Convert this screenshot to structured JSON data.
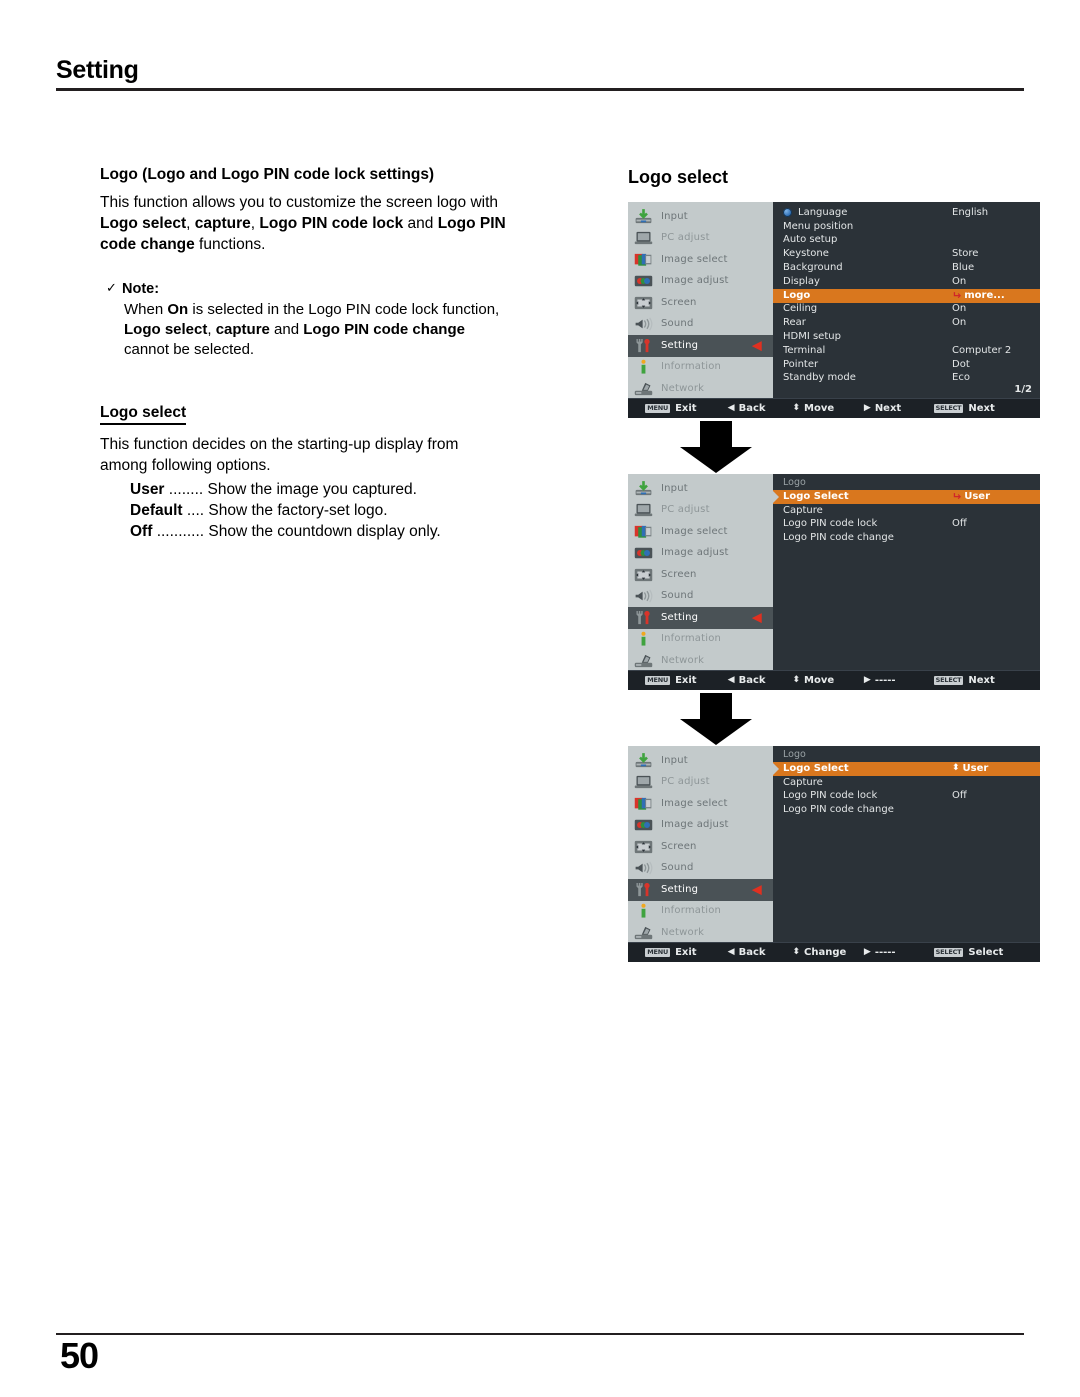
{
  "page": {
    "chapter_title": "Setting",
    "page_number": "50"
  },
  "left_column": {
    "section_heading": "Logo (Logo and Logo PIN code lock settings)",
    "intro_line1": "This function allows you to customize the screen logo with",
    "intro_b1": "Logo select",
    "intro_t1": ", ",
    "intro_b2": "capture",
    "intro_t2": ", ",
    "intro_b3": "Logo PIN code lock",
    "intro_t3": " and ",
    "intro_b4": "Logo PIN",
    "intro_b5": "code change",
    "intro_t4": " functions.",
    "note": {
      "check_glyph": "✓",
      "title": "Note:",
      "line1_a": "When ",
      "line1_b": "On",
      "line1_c": " is selected in the Logo PIN code lock function,",
      "line2_b1": "Logo select",
      "line2_t1": ", ",
      "line2_b2": "capture",
      "line2_t2": " and ",
      "line2_b3": "Logo PIN code change",
      "line3": "cannot be selected."
    },
    "subsection": {
      "heading": "Logo select",
      "desc_line1": "This function decides on the starting-up display from",
      "desc_line2": "among following options.",
      "options": [
        {
          "name": "User",
          "dots": " ........ ",
          "desc": "Show the image you captured."
        },
        {
          "name": "Default",
          "dots": " .... ",
          "desc": "Show the factory-set logo."
        },
        {
          "name": "Off",
          "dots": " ........... ",
          "desc": "Show the countdown display only."
        }
      ]
    }
  },
  "right_column": {
    "heading": "Logo select",
    "sidebar_items": [
      {
        "label": "Input",
        "icon": "input-icon"
      },
      {
        "label": "PC adjust",
        "icon": "pc-adjust-icon"
      },
      {
        "label": "Image select",
        "icon": "image-select-icon"
      },
      {
        "label": "Image adjust",
        "icon": "image-adjust-icon"
      },
      {
        "label": "Screen",
        "icon": "screen-icon"
      },
      {
        "label": "Sound",
        "icon": "sound-icon"
      },
      {
        "label": "Setting",
        "icon": "setting-icon"
      },
      {
        "label": "Information",
        "icon": "information-icon"
      },
      {
        "label": "Network",
        "icon": "network-icon"
      }
    ],
    "sidebar_caret": "◀",
    "osd_panels": [
      {
        "id": "setting-menu",
        "title": "",
        "rows": [
          {
            "label": "Language",
            "value": "English",
            "icon": "globe-icon",
            "selected": false
          },
          {
            "label": "Menu position",
            "value": "",
            "selected": false
          },
          {
            "label": "Auto setup",
            "value": "",
            "selected": false
          },
          {
            "label": "Keystone",
            "value": "Store",
            "selected": false
          },
          {
            "label": "Background",
            "value": "Blue",
            "selected": false
          },
          {
            "label": "Display",
            "value": "On",
            "selected": false
          },
          {
            "label": "Logo",
            "value": "more...",
            "selected": true,
            "marker": "return-arrow"
          },
          {
            "label": "Ceiling",
            "value": "On",
            "selected": false
          },
          {
            "label": "Rear",
            "value": "On",
            "selected": false
          },
          {
            "label": "HDMI setup",
            "value": "",
            "selected": false
          },
          {
            "label": "Terminal",
            "value": "Computer 2",
            "selected": false
          },
          {
            "label": "Pointer",
            "value": "Dot",
            "selected": false
          },
          {
            "label": "Standby mode",
            "value": "Eco",
            "selected": false
          }
        ],
        "page_indicator": "1/2",
        "footer": [
          {
            "keycap": "MENU",
            "glyph": "",
            "label": "Exit"
          },
          {
            "keycap": "",
            "glyph": "◀",
            "label": "Back"
          },
          {
            "keycap": "",
            "glyph": "⬍",
            "label": "Move"
          },
          {
            "keycap": "",
            "glyph": "▶",
            "label": "Next"
          },
          {
            "keycap": "SELECT",
            "glyph": "",
            "label": "Next"
          }
        ]
      },
      {
        "id": "logo-menu-next",
        "title": "Logo",
        "rows": [
          {
            "label": "Logo Select",
            "value": "User",
            "selected": true,
            "marker": "return-arrow"
          },
          {
            "label": "Capture",
            "value": "",
            "selected": false
          },
          {
            "label": "Logo PIN code lock",
            "value": "Off",
            "selected": false
          },
          {
            "label": "Logo PIN code change",
            "value": "",
            "selected": false
          }
        ],
        "page_indicator": "",
        "footer": [
          {
            "keycap": "MENU",
            "glyph": "",
            "label": "Exit"
          },
          {
            "keycap": "",
            "glyph": "◀",
            "label": "Back"
          },
          {
            "keycap": "",
            "glyph": "⬍",
            "label": "Move"
          },
          {
            "keycap": "",
            "glyph": "▶",
            "label": "-----"
          },
          {
            "keycap": "SELECT",
            "glyph": "",
            "label": "Next"
          }
        ]
      },
      {
        "id": "logo-menu-change",
        "title": "Logo",
        "rows": [
          {
            "label": "Logo Select",
            "value": "User",
            "selected": true,
            "marker": "updown-arrow"
          },
          {
            "label": "Capture",
            "value": "",
            "selected": false
          },
          {
            "label": "Logo PIN code lock",
            "value": "Off",
            "selected": false
          },
          {
            "label": "Logo PIN code change",
            "value": "",
            "selected": false
          }
        ],
        "page_indicator": "",
        "footer": [
          {
            "keycap": "MENU",
            "glyph": "",
            "label": "Exit"
          },
          {
            "keycap": "",
            "glyph": "◀",
            "label": "Back"
          },
          {
            "keycap": "",
            "glyph": "⬍",
            "label": "Change"
          },
          {
            "keycap": "",
            "glyph": "▶",
            "label": "-----"
          },
          {
            "keycap": "SELECT",
            "glyph": "",
            "label": "Select"
          }
        ]
      }
    ]
  },
  "colors": {
    "osd_bg": "#2b3238",
    "osd_sidebar": "#c3cacb",
    "osd_highlight": "#d9771e",
    "osd_active_item": "#4a5256",
    "osd_footer": "#1c2126",
    "caret_red": "#e03020"
  }
}
